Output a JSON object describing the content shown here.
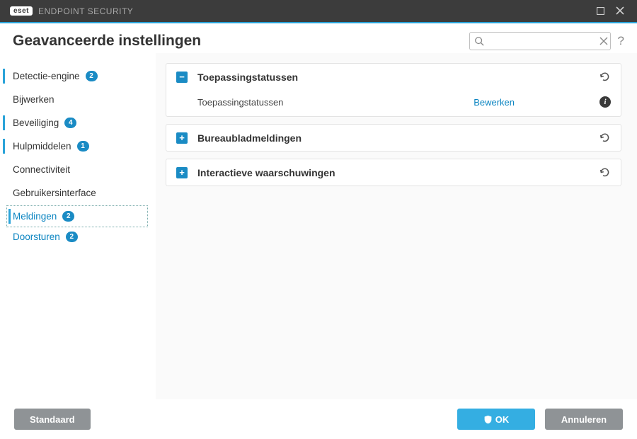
{
  "titlebar": {
    "logo": "eset",
    "product": "ENDPOINT SECURITY"
  },
  "page_title": "Geavanceerde instellingen",
  "search": {
    "placeholder": ""
  },
  "sidebar": [
    {
      "label": "Detectie-engine",
      "badge": "2",
      "selected": false,
      "marker": true
    },
    {
      "label": "Bijwerken",
      "badge": null,
      "selected": false,
      "marker": false
    },
    {
      "label": "Beveiliging",
      "badge": "4",
      "selected": false,
      "marker": true
    },
    {
      "label": "Hulpmiddelen",
      "badge": "1",
      "selected": false,
      "marker": true
    },
    {
      "label": "Connectiviteit",
      "badge": null,
      "selected": false,
      "marker": false
    },
    {
      "label": "Gebruikersinterface",
      "badge": null,
      "selected": false,
      "marker": false
    },
    {
      "label": "Meldingen",
      "badge": "2",
      "selected": true,
      "marker": true,
      "children": [
        {
          "label": "Doorsturen",
          "badge": "2"
        }
      ]
    }
  ],
  "panels": [
    {
      "expanded": true,
      "title": "Toepassingstatussen",
      "rows": [
        {
          "label": "Toepassingstatussen",
          "action": "Bewerken"
        }
      ]
    },
    {
      "expanded": false,
      "title": "Bureaubladmeldingen",
      "rows": []
    },
    {
      "expanded": false,
      "title": "Interactieve waarschuwingen",
      "rows": []
    }
  ],
  "footer": {
    "default": "Standaard",
    "ok": "OK",
    "cancel": "Annuleren"
  }
}
